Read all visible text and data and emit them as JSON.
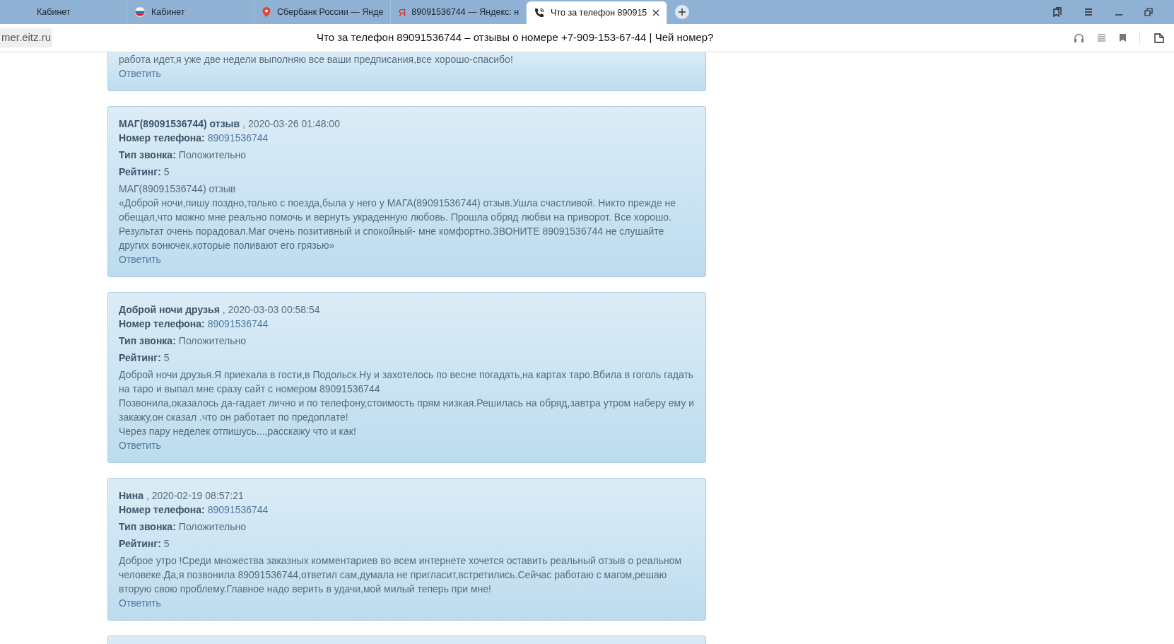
{
  "tabs": [
    {
      "label": "Кабинет",
      "kind": "none",
      "selected": false
    },
    {
      "label": "Кабинет",
      "kind": "flag",
      "selected": false
    },
    {
      "label": "Сбербанк России — Янде",
      "kind": "pin",
      "selected": false
    },
    {
      "label": "89091536744 — Яндекс: н",
      "kind": "letter",
      "glyph": "Я",
      "selected": false
    },
    {
      "label": "Что за телефон 890915",
      "kind": "phone",
      "selected": true
    }
  ],
  "address_bar": {
    "domain": "mer.eitz.ru",
    "page_title": "Что за телефон 89091536744 – отзывы о номере +7-909-153-67-44 | Чей номер?"
  },
  "reviews": [
    {
      "kind": "partial",
      "body": [
        "работа идет,я уже две недели выполняю все ваши предписания,все хорошо-спасибо!"
      ],
      "reply": "Ответить"
    },
    {
      "kind": "full",
      "author": "МАГ(89091536744) отзыв",
      "date": ", 2020-03-26 01:48:00",
      "phone_label": "Номер телефона:",
      "phone": "89091536744",
      "type_label": "Тип звонка:",
      "type": "Положительно",
      "rating_label": "Рейтинг:",
      "rating": "5",
      "body": [
        "МАГ(89091536744) отзыв",
        "«Доброй ночи,пишу поздно,только с поезда,была у него у МАГА(89091536744) отзыв.Ушла счастливой. Никто прежде не обещал,что можно мне реально помочь и вернуть украденную любовь. Прошла обряд любви на приворот. Все хорошо. Результат очень порадовал.Маг очень позитивный и спокойный- мне комфортно.ЗВОНИТЕ 89091536744 не слушайте других вонючек,которые поливают его грязью»"
      ],
      "reply": "Ответить"
    },
    {
      "kind": "full",
      "author": "Доброй ночи друзья",
      "date": ", 2020-03-03 00:58:54",
      "phone_label": "Номер телефона:",
      "phone": "89091536744",
      "type_label": "Тип звонка:",
      "type": "Положительно",
      "rating_label": "Рейтинг:",
      "rating": "5",
      "body": [
        "Доброй ночи друзья.Я приехала в гости,в Подольск.Ну и захотелось по весне погадать,на картах таро.Вбила в гоголь гадать на таро и выпал мне сразу сайт с номером 89091536744",
        "Позвонила,оказалось да-гадает лично и по телефону,стоимость прям низкая.Решилась на обряд,завтра утром наберу ему и закажу,он сказал .что он работает по предоплате!",
        "Через пару неделек отпишусь...,расскажу что и как!"
      ],
      "reply": "Ответить"
    },
    {
      "kind": "full",
      "author": "Нина",
      "date": ", 2020-02-19 08:57:21",
      "phone_label": "Номер телефона:",
      "phone": "89091536744",
      "type_label": "Тип звонка:",
      "type": "Положительно",
      "rating_label": "Рейтинг:",
      "rating": "5",
      "body": [
        "Доброе утро !Среди множества заказных комментариев во всем интернете хочется оставить реальный отзыв о реальном человеке.Да,я позвонила 89091536744,ответил сам,думала не пригласит,встретились.Сейчас работаю с магом,решаю вторую свою проблему.Главное надо верить в удачи,мой милый теперь при мне!"
      ],
      "reply": "Ответить"
    },
    {
      "kind": "empty"
    }
  ]
}
